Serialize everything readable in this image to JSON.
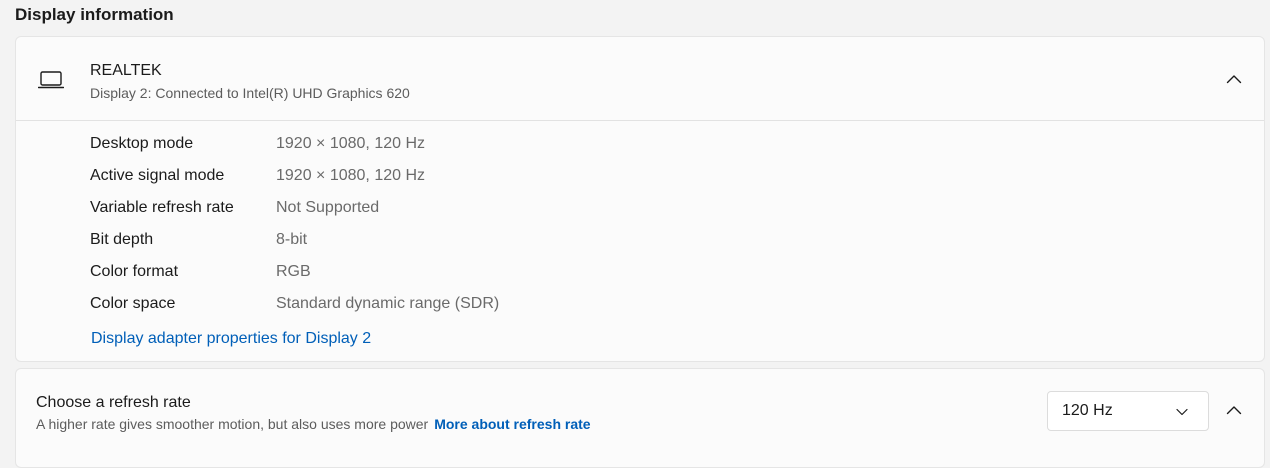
{
  "section": {
    "title": "Display information"
  },
  "display": {
    "name": "REALTEK",
    "subtitle": "Display 2: Connected to Intel(R) UHD Graphics 620",
    "icon": "laptop-icon",
    "rows": [
      {
        "label": "Desktop mode",
        "value": "1920 × 1080, 120 Hz"
      },
      {
        "label": "Active signal mode",
        "value": "1920 × 1080, 120 Hz"
      },
      {
        "label": "Variable refresh rate",
        "value": "Not Supported"
      },
      {
        "label": "Bit depth",
        "value": "8-bit"
      },
      {
        "label": "Color format",
        "value": "RGB"
      },
      {
        "label": "Color space",
        "value": "Standard dynamic range (SDR)"
      }
    ],
    "adapter_link": "Display adapter properties for Display 2"
  },
  "refresh": {
    "title": "Choose a refresh rate",
    "description": "A higher rate gives smoother motion, but also uses more power",
    "link": "More about refresh rate",
    "selected_rate": "120 Hz"
  },
  "colors": {
    "accent": "#005fb8",
    "card_bg": "#fbfbfb",
    "page_bg": "#f3f3f3"
  }
}
